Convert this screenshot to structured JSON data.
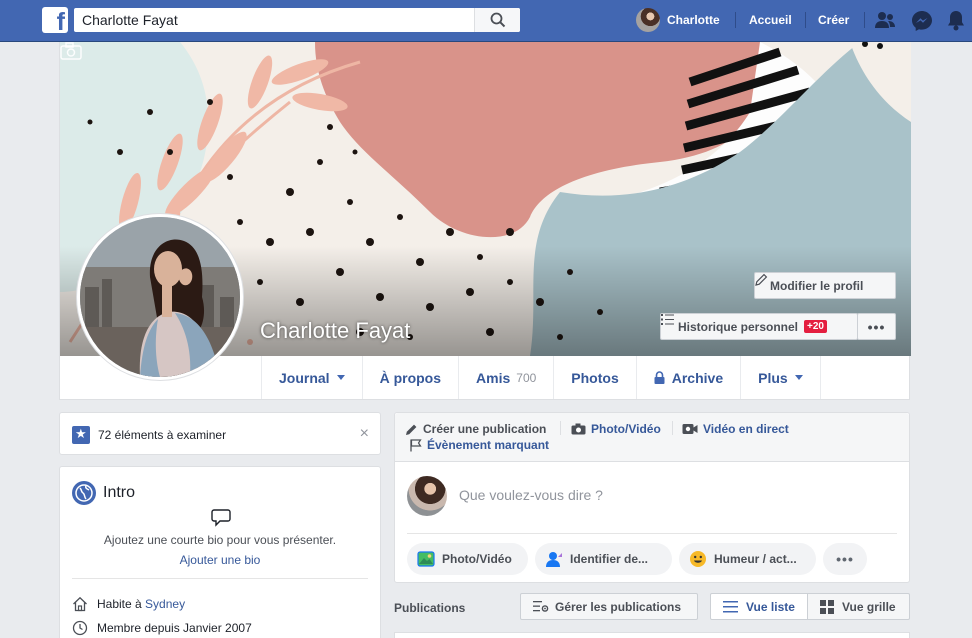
{
  "topbar": {
    "search_value": "Charlotte Fayat",
    "user_name": "Charlotte",
    "home": "Accueil",
    "create": "Créer"
  },
  "profile": {
    "name": "Charlotte Fayat",
    "edit_profile": "Modifier le profil",
    "history": "Historique personnel",
    "history_badge": "+20",
    "more": "•••"
  },
  "tabs": [
    {
      "label": "Journal"
    },
    {
      "label": "À propos"
    },
    {
      "label": "Amis",
      "count": "700"
    },
    {
      "label": "Photos"
    },
    {
      "label": "Archive"
    },
    {
      "label": "Plus"
    }
  ],
  "review": {
    "text": "72 éléments à examiner",
    "close": "×"
  },
  "intro": {
    "title": "Intro",
    "bio_prompt": "Ajoutez une courte bio pour vous présenter.",
    "bio_link": "Ajouter une bio",
    "lives_prefix": "Habite à",
    "lives_city": "Sydney",
    "member_since": "Membre depuis Janvier 2007"
  },
  "composer": {
    "create_post": "Créer une publication",
    "photo_video": "Photo/Vidéo",
    "live_video": "Vidéo en direct",
    "life_event": "Évènement marquant",
    "placeholder": "Que voulez-vous dire ?",
    "pill_photo": "Photo/Vidéo",
    "pill_tag": "Identifier de...",
    "pill_mood": "Humeur / act...",
    "pill_more": "•••"
  },
  "publications": {
    "label": "Publications",
    "manage": "Gérer les publications",
    "list_view": "Vue liste",
    "grid_view": "Vue grille"
  },
  "colors": {
    "brand": "#4267b2",
    "link": "#365899",
    "badge": "#e41e3f"
  }
}
